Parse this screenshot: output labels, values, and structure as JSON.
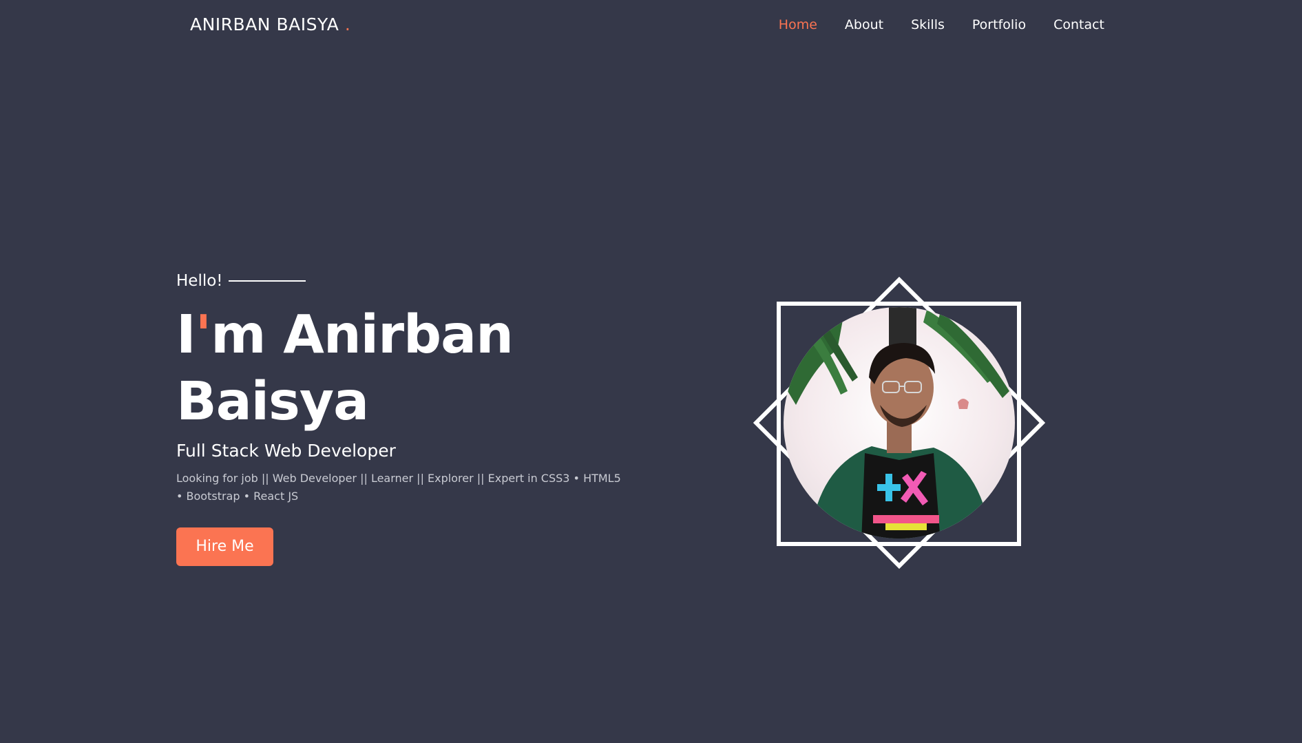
{
  "brand": {
    "name": "ANIRBAN BAISYA",
    "dot": "."
  },
  "nav": {
    "items": [
      {
        "label": "Home",
        "active": true
      },
      {
        "label": "About",
        "active": false
      },
      {
        "label": "Skills",
        "active": false
      },
      {
        "label": "Portfolio",
        "active": false
      },
      {
        "label": "Contact",
        "active": false
      }
    ]
  },
  "hero": {
    "greeting": "Hello!",
    "headline_pre": "I",
    "headline_apos": "'",
    "headline_line1_rest": "m Anirban",
    "headline_line2": "Baisya",
    "role": "Full Stack Web Developer",
    "tagline": "Looking for job || Web Developer || Learner || Explorer || Expert in CSS3 • HTML5 • Bootstrap • React JS",
    "cta_label": "Hire Me",
    "image_icon": "profile-photo"
  },
  "colors": {
    "background": "#353849",
    "accent": "#fb7452",
    "text": "#ffffff",
    "muted": "#c9cbd3"
  }
}
